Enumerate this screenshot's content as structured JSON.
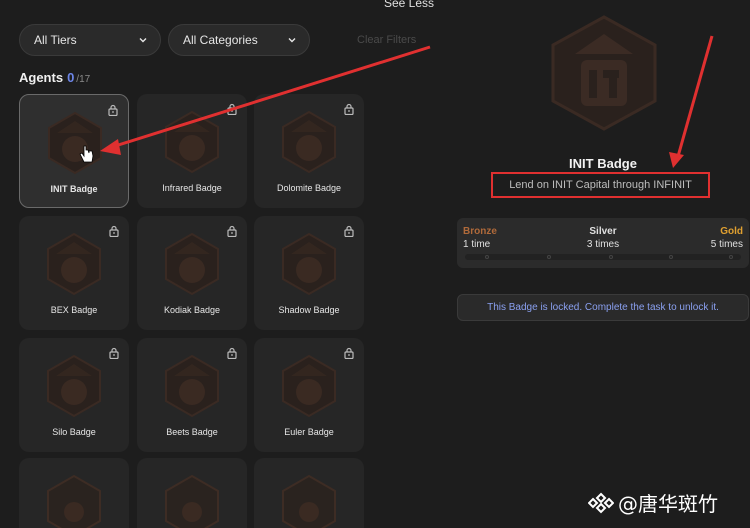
{
  "header": {
    "see_less": "See Less",
    "clear_filters": "Clear Filters"
  },
  "filters": {
    "tiers": "All Tiers",
    "categories": "All Categories"
  },
  "agents": {
    "title": "Agents",
    "unlocked": "0",
    "total": "/17"
  },
  "badges": [
    {
      "name": "INIT Badge",
      "icon": "init-icon",
      "selected": true
    },
    {
      "name": "Infrared Badge",
      "icon": "infrared-icon"
    },
    {
      "name": "Dolomite Badge",
      "icon": "dolomite-icon"
    },
    {
      "name": "BEX Badge",
      "icon": "bex-icon"
    },
    {
      "name": "Kodiak Badge",
      "icon": "kodiak-icon"
    },
    {
      "name": "Shadow Badge",
      "icon": "shadow-icon"
    },
    {
      "name": "Silo Badge",
      "icon": "silo-icon"
    },
    {
      "name": "Beets Badge",
      "icon": "beets-icon"
    },
    {
      "name": "Euler Badge",
      "icon": "euler-icon"
    }
  ],
  "detail": {
    "title": "INIT Badge",
    "description": "Lend on INIT Capital through INFINIT",
    "tiers": [
      {
        "name": "Bronze",
        "value": "1 time",
        "color": "#b06a3a"
      },
      {
        "name": "Silver",
        "value": "3 times",
        "color": "#e0e0e0"
      },
      {
        "name": "Gold",
        "value": "5 times",
        "color": "#e0a030"
      }
    ],
    "locked_message": "This Badge is locked. Complete the task to unlock it."
  },
  "watermark": "@唐华斑竹",
  "colors": {
    "accent": "#6d86e8",
    "highlight": "#e03030",
    "badge": "#3a2a22"
  }
}
